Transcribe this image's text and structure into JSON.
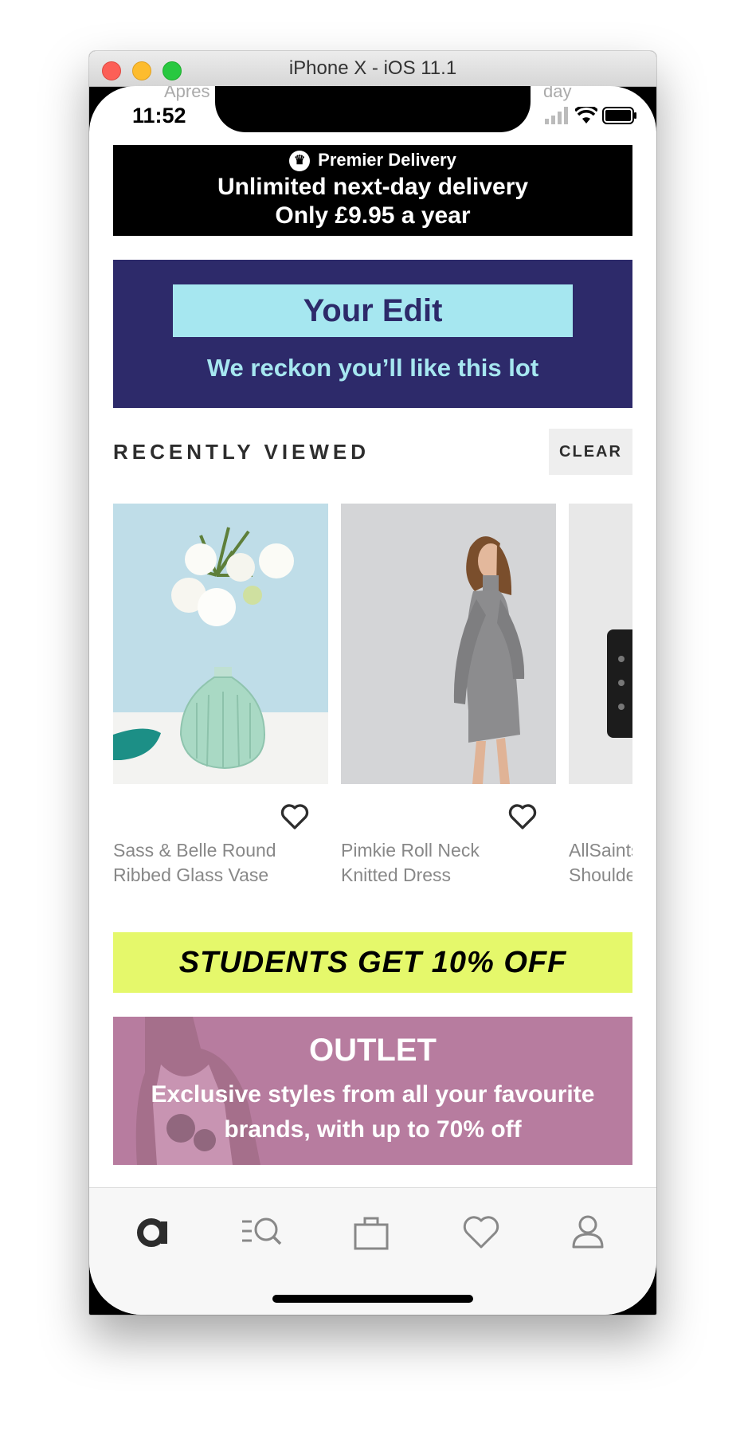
{
  "window": {
    "title": "iPhone X - iOS 11.1"
  },
  "status_bar": {
    "time": "11:52"
  },
  "behind_content": {
    "left_text": "Apres",
    "right_text": "day"
  },
  "premier": {
    "label": "Premier Delivery",
    "line1": "Unlimited next-day delivery",
    "line2": "Only £9.95 a year"
  },
  "your_edit": {
    "title": "Your Edit",
    "subtitle": "We reckon you’ll like this lot"
  },
  "recently_viewed": {
    "title": "RECENTLY VIEWED",
    "clear_label": "CLEAR",
    "items": [
      {
        "name_line1": "Sass & Belle Round",
        "name_line2": "Ribbed Glass Vase"
      },
      {
        "name_line1": "Pimkie Roll Neck",
        "name_line2": "Knitted Dress"
      },
      {
        "name_line1": "AllSaints",
        "name_line2": "Shoulde"
      }
    ]
  },
  "students_banner": {
    "text": "STUDENTS GET 10% OFF"
  },
  "outlet": {
    "title": "OUTLET",
    "subtitle": "Exclusive styles from all your favourite brands, with up to 70% off"
  },
  "tab_bar": {
    "tabs": [
      {
        "icon": "home-logo-icon",
        "active": true
      },
      {
        "icon": "search-icon",
        "active": false
      },
      {
        "icon": "bag-icon",
        "active": false
      },
      {
        "icon": "heart-icon",
        "active": false
      },
      {
        "icon": "account-icon",
        "active": false
      }
    ]
  },
  "colors": {
    "premier_bg": "#000000",
    "edit_bg": "#2d2a6a",
    "edit_accent": "#a6e7f0",
    "students_bg": "#e5f86b",
    "outlet_bg": "#b77c9f"
  }
}
